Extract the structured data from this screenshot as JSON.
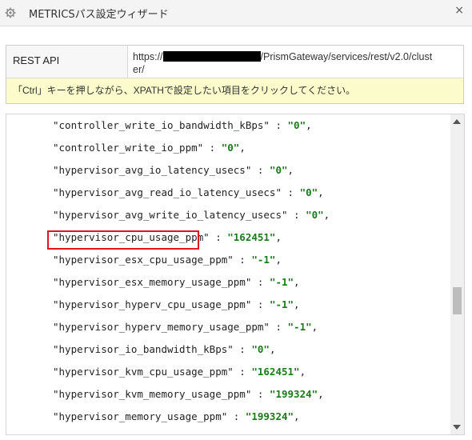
{
  "window": {
    "title": "METRICSパス設定ウィザード",
    "close_symbol": "×",
    "settings_icon": "gear-icon",
    "close_icon": "close-icon"
  },
  "api": {
    "label": "REST API",
    "url_prefix": "https://",
    "url_suffix": "/PrismGateway/services/rest/v2.0/clust",
    "url_wrap": "er/"
  },
  "hint": "「Ctrl」キーを押しながら、XPATHで設定したい項目をクリックしてください。",
  "code": {
    "lines": [
      {
        "key": "\"controller_write_io_bandwidth_kBps\"",
        "value": "\"0\""
      },
      {
        "key": "\"controller_write_io_ppm\"",
        "value": "\"0\""
      },
      {
        "key": "\"hypervisor_avg_io_latency_usecs\"",
        "value": "\"0\""
      },
      {
        "key": "\"hypervisor_avg_read_io_latency_usecs\"",
        "value": "\"0\""
      },
      {
        "key": "\"hypervisor_avg_write_io_latency_usecs\"",
        "value": "\"0\""
      },
      {
        "key": "\"hypervisor_cpu_usage_ppm\"",
        "value": "\"162451\""
      },
      {
        "key": "\"hypervisor_esx_cpu_usage_ppm\"",
        "value": "\"-1\""
      },
      {
        "key": "\"hypervisor_esx_memory_usage_ppm\"",
        "value": "\"-1\""
      },
      {
        "key": "\"hypervisor_hyperv_cpu_usage_ppm\"",
        "value": "\"-1\""
      },
      {
        "key": "\"hypervisor_hyperv_memory_usage_ppm\"",
        "value": "\"-1\""
      },
      {
        "key": "\"hypervisor_io_bandwidth_kBps\"",
        "value": "\"0\""
      },
      {
        "key": "\"hypervisor_kvm_cpu_usage_ppm\"",
        "value": "\"162451\""
      },
      {
        "key": "\"hypervisor_kvm_memory_usage_ppm\"",
        "value": "\"199324\""
      },
      {
        "key": "\"hypervisor_memory_usage_ppm\"",
        "value": "\"199324\""
      }
    ],
    "separator": " : ",
    "trailing": ",",
    "highlight_color": "#e0151f",
    "value_color": "#1b7a1b"
  },
  "scrollbar": {
    "position_fraction": 0.6
  }
}
